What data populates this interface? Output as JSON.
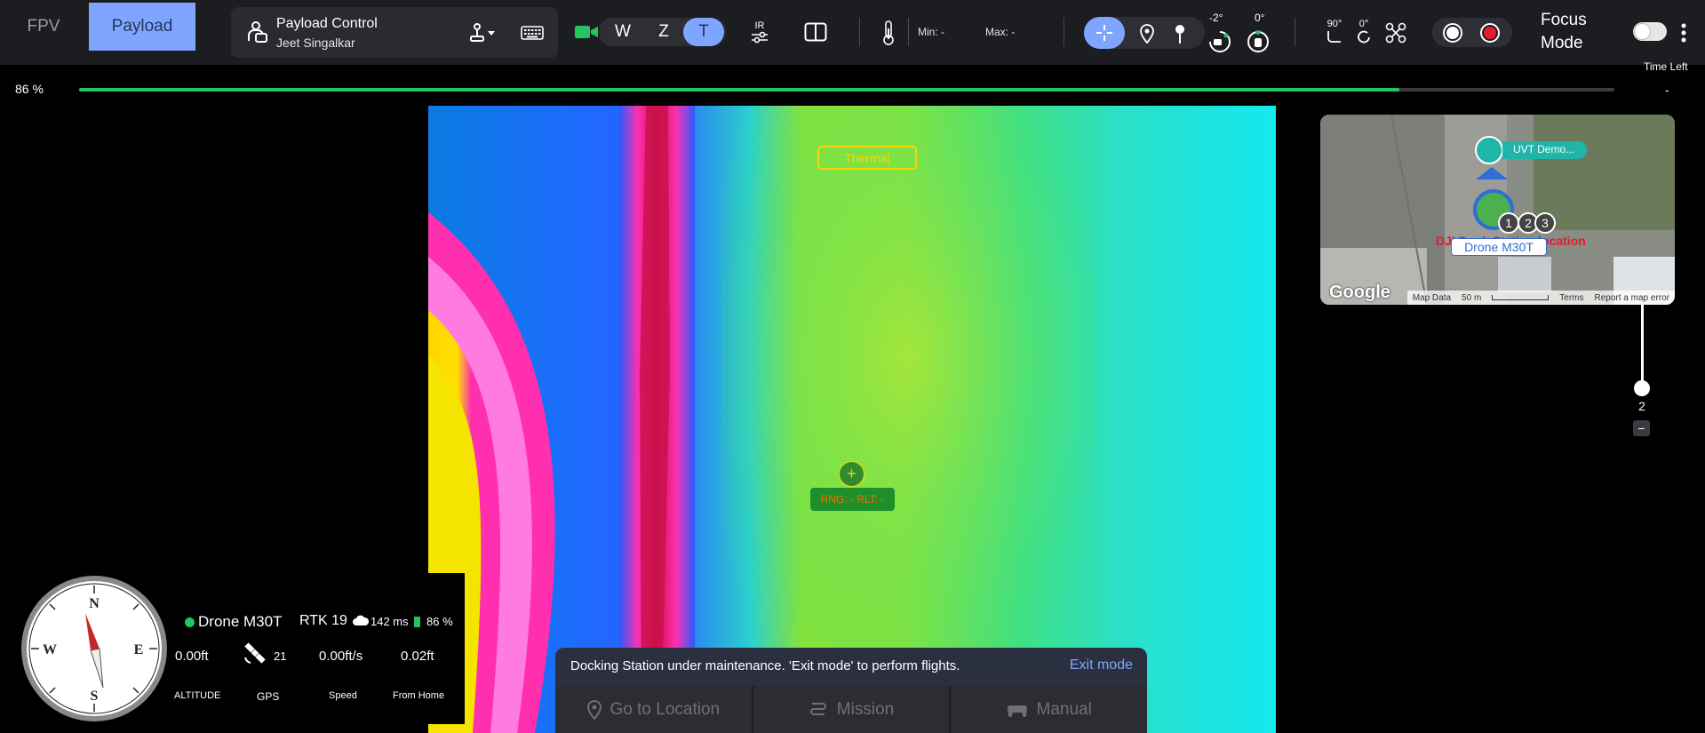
{
  "top_tabs": {
    "fpv": "FPV",
    "payload": "Payload"
  },
  "payload_control": {
    "title": "Payload Control",
    "user": "Jeet Singalkar"
  },
  "zoom": {
    "w": "W",
    "z": "Z",
    "t": "T",
    "active": "T"
  },
  "ir_label": "IR",
  "temperature": {
    "min": "Min: -",
    "max": "Max: -"
  },
  "gimbal": {
    "pitch": "-2°",
    "yaw": "0°"
  },
  "gimbal_presets": {
    "down": "90°",
    "reset": "0°"
  },
  "focus_mode": {
    "label": "Focus Mode",
    "enabled": false
  },
  "time_left": {
    "label": "Time Left",
    "value": "-"
  },
  "battery": {
    "percent_text": "86 %",
    "level": 0.86,
    "color": "#22c55e"
  },
  "feed": {
    "thermal_label": "Thermal",
    "rng_label": "RNG: -  RLT: -"
  },
  "map": {
    "google": "Google",
    "location_label": "UVT Demo...",
    "dock_label": "DJI Dock Station location",
    "drone_label": "Drone M30T",
    "waypoints": [
      "1",
      "2",
      "3"
    ],
    "attribution": {
      "map_data": "Map Data",
      "scale": "50 m",
      "terms": "Terms",
      "report": "Report a map error"
    }
  },
  "map_zoom": {
    "value": "2",
    "minus": "−"
  },
  "compass": {
    "n": "N",
    "e": "E",
    "s": "S",
    "w": "W"
  },
  "telemetry": {
    "drone_name": "Drone M30T",
    "rtk": "RTK 19",
    "latency": "142 ms",
    "battery": "86 %",
    "altitude_value": "0.00ft",
    "altitude_label": "ALTITUDE",
    "gps_value": "21",
    "gps_label": "GPS",
    "speed_value": "0.00ft/s",
    "speed_label": "Speed",
    "home_value": "0.02ft",
    "home_label": "From Home"
  },
  "notice": {
    "text": "Docking Station under maintenance. 'Exit mode' to perform flights.",
    "exit": "Exit mode"
  },
  "modes": {
    "go_to_location": "Go to Location",
    "mission": "Mission",
    "manual": "Manual"
  },
  "colors": {
    "accent": "#7fa6ff",
    "topbar": "#1c1d21",
    "record": "#e8192c",
    "battery": "#22c55e"
  }
}
